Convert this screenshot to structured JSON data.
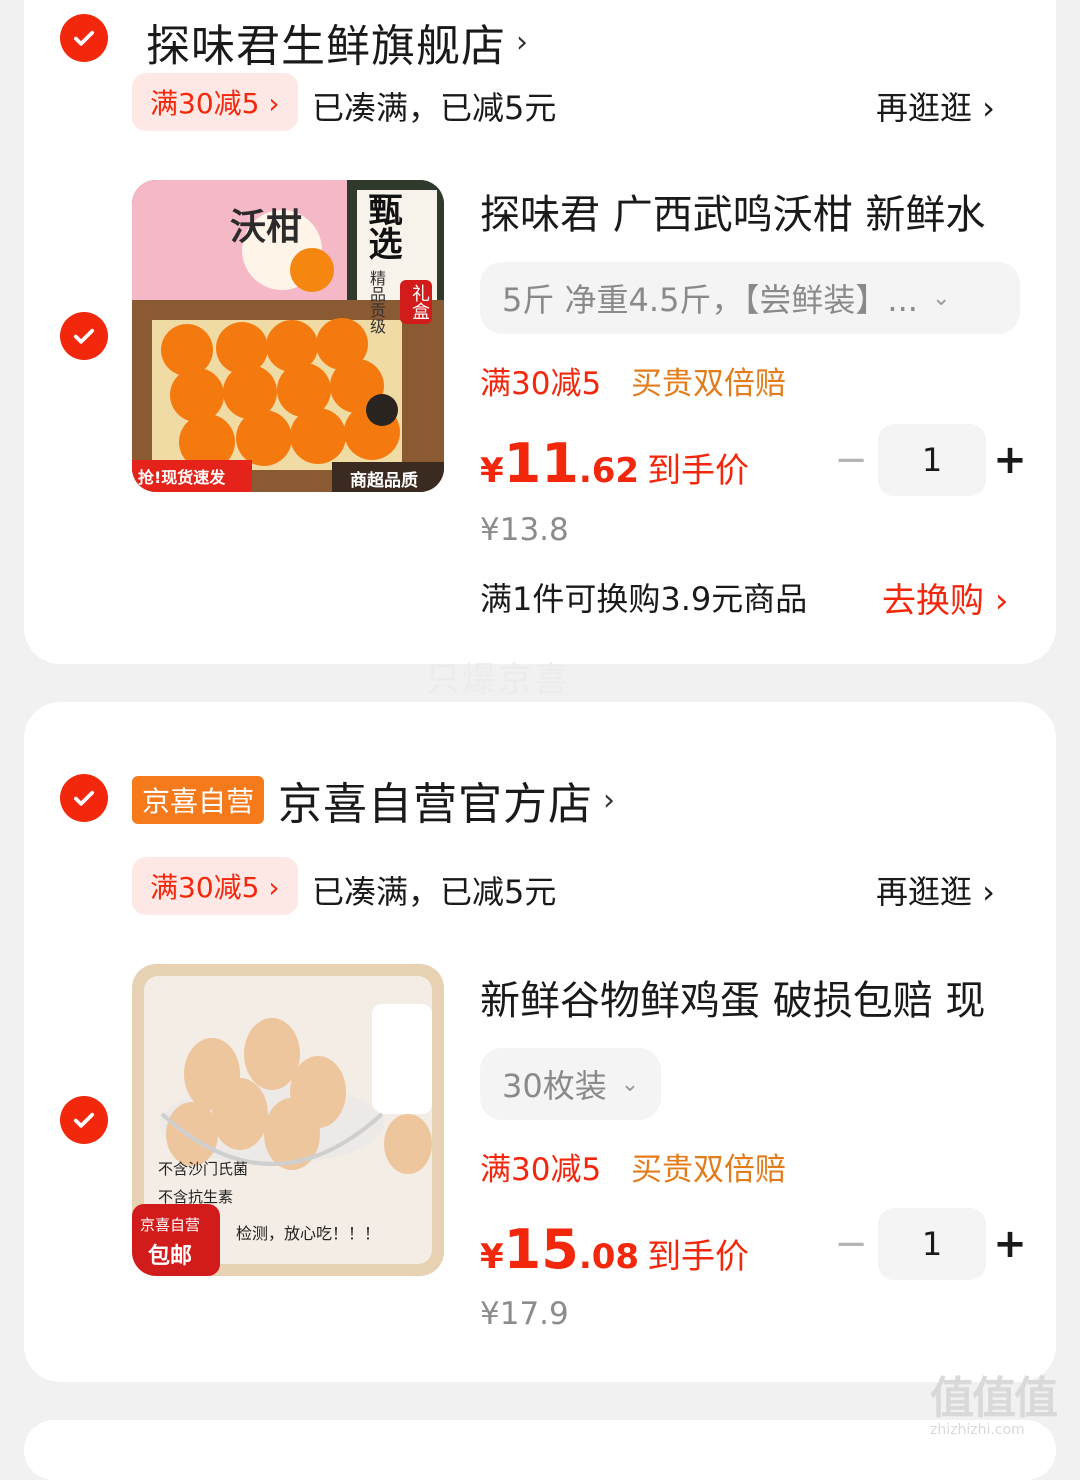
{
  "stores": [
    {
      "name": "探味君生鲜旗舰店",
      "badge": "",
      "promo_tag": "满30减5 ›",
      "promo_text": "已凑满，已减5元",
      "more": "再逛逛 ›",
      "item": {
        "title": "探味君 广西武鸣沃柑 新鲜水",
        "spec": "5斤 净重4.5斤，【尝鲜装】...",
        "tag_promo": "满30减5",
        "tag_guarantee": "买贵双倍赔",
        "price_currency": "¥",
        "price_int": "11",
        "price_dec": ".62",
        "price_label": "到手价",
        "orig_price": "¥13.8",
        "qty": "1",
        "exchange_text": "满1件可换购3.9元商品",
        "exchange_link": "去换购 ›",
        "image_texts": {
          "badge_left": "抢!现货速发",
          "badge_right": "商超品质",
          "box_title": "沃柑",
          "side_big": "甄选",
          "side_small": "精品贡级",
          "side_gift": "礼盒"
        }
      }
    },
    {
      "name": "京喜自营官方店",
      "badge": "京喜自营",
      "promo_tag": "满30减5 ›",
      "promo_text": "已凑满，已减5元",
      "more": "再逛逛 ›",
      "item": {
        "title": "新鲜谷物鲜鸡蛋 破损包赔 现",
        "spec": "30枚装",
        "tag_promo": "满30减5",
        "tag_guarantee": "买贵双倍赔",
        "price_currency": "¥",
        "price_int": "15",
        "price_dec": ".08",
        "price_label": "到手价",
        "orig_price": "¥17.9",
        "qty": "1",
        "image_texts": {
          "line1": "不含沙门氏菌",
          "line2": "不含抗生素",
          "line3": "检测，放心吃！！！",
          "badge": "京喜自营",
          "badge2": "包邮"
        }
      }
    }
  ],
  "qty_minus": "−",
  "qty_plus": "+",
  "watermark": "只爆京喜",
  "corner_watermark": "值值值",
  "corner_watermark_url": "zhizhizhi.com",
  "icons": {
    "check": "check-icon",
    "chevron": "chevron-right-icon",
    "dropdown": "chevron-down-icon"
  },
  "colors": {
    "accent": "#f2270c",
    "orange": "#e37c1a",
    "badge": "#f47a1c"
  }
}
